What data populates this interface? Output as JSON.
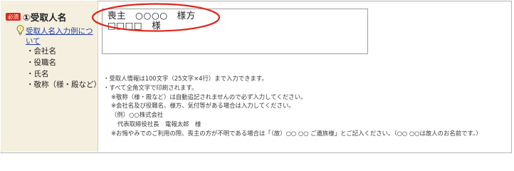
{
  "form": {
    "required_badge": "必須",
    "field_title": "①受取人名",
    "bulb_icon": "lightbulb-icon",
    "help_link": "受取人名入力例について",
    "items": [
      "・会社名",
      "・役職名",
      "・氏名",
      "・敬称（様・殿など）"
    ]
  },
  "textarea": {
    "lines": [
      "喪主　○○○○　様方",
      "□□□□　様"
    ]
  },
  "notes": {
    "lines": [
      "・受取人情報は100文字（25文字×4行）まで入力できます。",
      "・すべて全角文字で印刷されます。",
      "※敬称（様・殿など）は自動追記されませんので必ず入力してください。",
      "※会社名及び役職名、様方、気付等がある場合は入力してください。",
      "（例）○○株式会社",
      "代表取締役社長　電報太郎　様",
      "※お悔やみでのご利用の際、喪主の方が不明である場合は「（故）○○ ○○ ご遺族様」とご記入ください。（○○ ○○は故人のお名前です。）"
    ]
  },
  "colors": {
    "label_background": "#f5efe0",
    "required_red": "#d92a1c",
    "link_blue": "#1f3fa6",
    "annotation_red": "#e0261b"
  }
}
